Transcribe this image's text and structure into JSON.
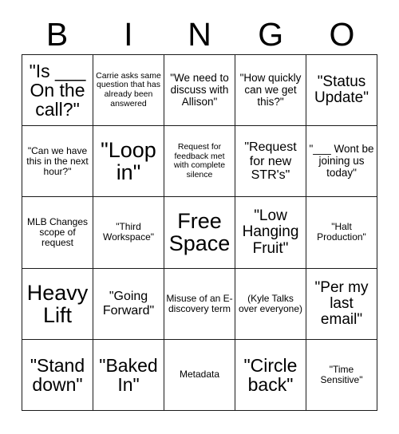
{
  "card": {
    "title_letters": [
      "B",
      "I",
      "N",
      "G",
      "O"
    ],
    "free_space_label": "Free Space",
    "colors": {
      "background": "#ffffff",
      "text": "#000000",
      "grid_line": "#1a1a1a"
    },
    "rows": [
      [
        {
          "text": "\"Is ___ On the call?\"",
          "size": "xl"
        },
        {
          "text": "Carrie asks same question that has already been answered",
          "size": "xxs"
        },
        {
          "text": "\"We need to discuss with Allison\"",
          "size": "s"
        },
        {
          "text": "\"How quickly can we get this?\"",
          "size": "s"
        },
        {
          "text": "\"Status Update\"",
          "size": "l"
        }
      ],
      [
        {
          "text": "\"Can we have this in the next hour?\"",
          "size": "xs"
        },
        {
          "text": "\"Loop in\"",
          "size": "xxl"
        },
        {
          "text": "Request for feedback met with complete silence",
          "size": "xxs"
        },
        {
          "text": "\"Request for new STR's\"",
          "size": "m"
        },
        {
          "text": "\"___ Wont be joining us today\"",
          "size": "s"
        }
      ],
      [
        {
          "text": "MLB Changes scope of request",
          "size": "xs"
        },
        {
          "text": "\"Third Workspace\"",
          "size": "xs"
        },
        {
          "text": "Free Space",
          "size": "xxl"
        },
        {
          "text": "\"Low Hanging Fruit\"",
          "size": "l"
        },
        {
          "text": "\"Halt Production\"",
          "size": "xs"
        }
      ],
      [
        {
          "text": "Heavy Lift",
          "size": "xxl"
        },
        {
          "text": "\"Going Forward\"",
          "size": "m"
        },
        {
          "text": "Misuse of an E-discovery term",
          "size": "xs"
        },
        {
          "text": "(Kyle Talks over everyone)",
          "size": "xs"
        },
        {
          "text": "\"Per my last email\"",
          "size": "l"
        }
      ],
      [
        {
          "text": "\"Stand down\"",
          "size": "xl"
        },
        {
          "text": "\"Baked In\"",
          "size": "xl"
        },
        {
          "text": "Metadata",
          "size": "xs"
        },
        {
          "text": "\"Circle back\"",
          "size": "xl"
        },
        {
          "text": "\"Time Sensitive\"",
          "size": "xs"
        }
      ]
    ]
  }
}
